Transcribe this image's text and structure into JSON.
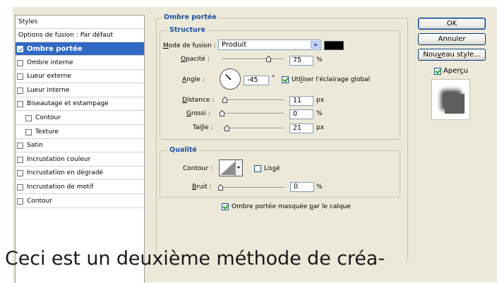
{
  "left_list": {
    "header": "Styles",
    "options_label": "Options de fusion : Par défaut",
    "items": [
      {
        "label": "Ombre portée",
        "checked": true,
        "selected": true
      },
      {
        "label": "Ombre interne",
        "checked": false
      },
      {
        "label": "Lueur externe",
        "checked": false
      },
      {
        "label": "Lueur interne",
        "checked": false
      },
      {
        "label": "Biseautage et estampage",
        "checked": false
      },
      {
        "label": "Contour",
        "checked": false,
        "indent": true
      },
      {
        "label": "Texture",
        "checked": false,
        "indent": true
      },
      {
        "label": "Satin",
        "checked": false
      },
      {
        "label": "Incrustation couleur",
        "checked": false
      },
      {
        "label": "Incrustation en dégradé",
        "checked": false
      },
      {
        "label": "Incrustation de motif",
        "checked": false
      },
      {
        "label": "Contour",
        "checked": false
      }
    ]
  },
  "drop_shadow": {
    "title": "Ombre portée",
    "structure": {
      "title": "Structure",
      "blend_mode_label": "Mode de fusion :",
      "blend_mode_value": "Produit",
      "shadow_color": "#000000",
      "opacity_label": "Opacité :",
      "opacity_value": "75",
      "opacity_unit": "%",
      "opacity_fraction": 0.75,
      "angle_label": "Angle :",
      "angle_value": "-45",
      "angle_unit": "°",
      "global_light_label": "Utiliser l'éclairage global",
      "global_light_checked": true,
      "distance_label": "Distance :",
      "distance_value": "11",
      "distance_unit": "px",
      "distance_fraction": 0.04,
      "spread_label": "Grossi :",
      "spread_value": "0",
      "spread_unit": "%",
      "spread_fraction": 0.0,
      "size_label": "Taille :",
      "size_value": "21",
      "size_unit": "px",
      "size_fraction": 0.08
    },
    "quality": {
      "title": "Qualité",
      "contour_label": "Contour :",
      "antialias_label": "Lissé",
      "antialias_checked": false,
      "noise_label": "Bruit :",
      "noise_value": "0",
      "noise_unit": "%",
      "noise_fraction": 0.0
    },
    "knockout_label": "Ombre portée masquée par le calque",
    "knockout_checked": true
  },
  "buttons": {
    "ok": "OK",
    "cancel": "Annuler",
    "new_style": "Nouveau style...",
    "preview_label": "Aperçu",
    "preview_checked": true
  },
  "caption": "Ceci est un deuxième méthode de créa-",
  "colors": {
    "selection": "#316ac5",
    "group_title": "#1f4fa0",
    "dialog_bg": "#ece9d8"
  }
}
